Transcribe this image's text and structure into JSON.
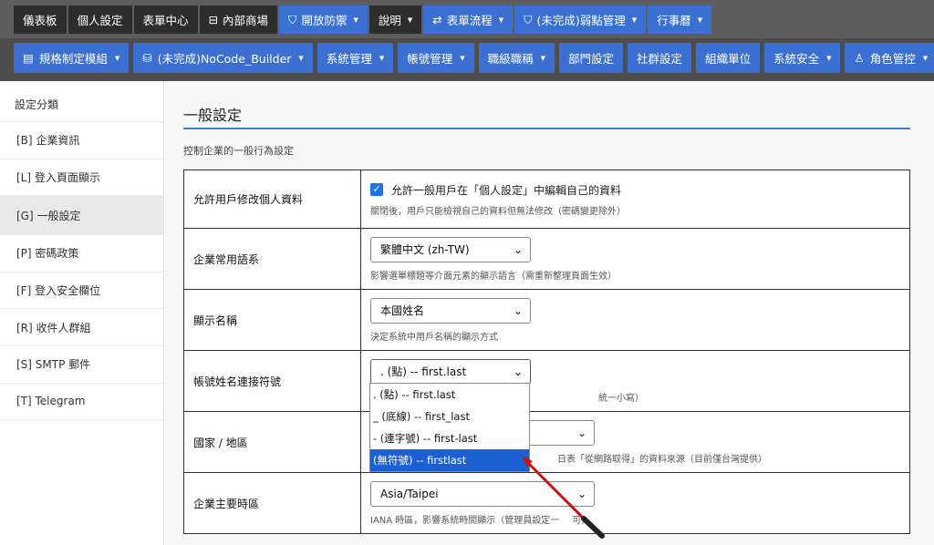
{
  "top_nav": [
    {
      "label": "儀表板",
      "style": "dark",
      "icon": ""
    },
    {
      "label": "個人設定",
      "style": "dark",
      "icon": ""
    },
    {
      "label": "表單中心",
      "style": "dark",
      "icon": ""
    },
    {
      "label": "內部商場",
      "style": "dark",
      "icon": "shop-icon"
    },
    {
      "label": "開放防禦",
      "style": "blue",
      "icon": "shield-icon",
      "caret": true
    },
    {
      "label": "說明",
      "style": "dark",
      "icon": "",
      "caret": true
    },
    {
      "label": "表單流程",
      "style": "blue",
      "icon": "flow-icon",
      "caret": true
    },
    {
      "label": "(未完成)弱點管理",
      "style": "blue",
      "icon": "shield-check-icon",
      "caret": true
    },
    {
      "label": "行事曆",
      "style": "blue",
      "icon": "",
      "caret": true
    }
  ],
  "sec_nav": [
    {
      "label": "規格制定模組",
      "icon": "grid-icon",
      "caret": true
    },
    {
      "label": "(未完成)NoCode_Builder",
      "icon": "database-icon",
      "caret": true
    },
    {
      "label": "系統管理",
      "icon": "",
      "caret": true
    },
    {
      "label": "帳號管理",
      "icon": "",
      "caret": true
    },
    {
      "label": "職級職稱",
      "icon": "",
      "caret": true
    },
    {
      "label": "部門設定",
      "icon": "",
      "caret": false
    },
    {
      "label": "社群設定",
      "icon": "",
      "caret": false
    },
    {
      "label": "組織單位",
      "icon": "",
      "caret": false
    },
    {
      "label": "系統安全",
      "icon": "",
      "caret": true
    },
    {
      "label": "角色管控",
      "icon": "user-icon",
      "caret": true
    }
  ],
  "caret_glyph": "▼",
  "sidebar": {
    "header": "設定分類",
    "items": [
      {
        "label": "[B]  企業資訊",
        "active": false
      },
      {
        "label": "[L]  登入頁面顯示",
        "active": false
      },
      {
        "label": "[G]  一般設定",
        "active": true
      },
      {
        "label": "[P]  密碼政策",
        "active": false
      },
      {
        "label": "[F]  登入安全欄位",
        "active": false
      },
      {
        "label": "[R]  收件人群組",
        "active": false
      },
      {
        "label": "[S]  SMTP 郵件",
        "active": false
      },
      {
        "label": "[T]  Telegram",
        "active": false
      }
    ]
  },
  "page": {
    "title": "一般設定",
    "description": "控制企業的一般行為設定"
  },
  "settings": {
    "allow_edit": {
      "label": "允許用戶修改個人資料",
      "checkbox_label": "允許一般用戶在「個人設定」中編輯自己的資料",
      "checked": true,
      "help": "關閉後，用戶只能檢視自己的資料但無法修改（密碼變更除外）"
    },
    "language": {
      "label": "企業常用語系",
      "value": "繁體中文 (zh-TW)",
      "help": "影響選單標題等介面元素的顯示語言（需重新整理頁面生效）"
    },
    "display_name": {
      "label": "顯示名稱",
      "value": "本國姓名",
      "help": "決定系統中用戶名稱的顯示方式"
    },
    "separator": {
      "label": "帳號姓名連接符號",
      "value": ". (點) -- first.last",
      "help_visible": "統一小寫）"
    },
    "country": {
      "label": "國家 / 地區",
      "value": "",
      "help_visible": "日表「從網路取得」的資料來源（目前僅台灣提供）"
    },
    "timezone": {
      "label": "企業主要時區",
      "value": "Asia/Taipei",
      "help_left": "IANA 時區，影響系統時間顯示（管理員設定一",
      "help_right": "可）"
    }
  },
  "dropdown_options": [
    {
      "label": ". (點) -- first.last",
      "selected": false
    },
    {
      "label": "_ (底線) -- first_last",
      "selected": false
    },
    {
      "label": "- (連字號) -- first-last",
      "selected": false
    },
    {
      "label": "(無符號) -- firstlast",
      "selected": true
    }
  ],
  "pointer_color": "#cc1111"
}
